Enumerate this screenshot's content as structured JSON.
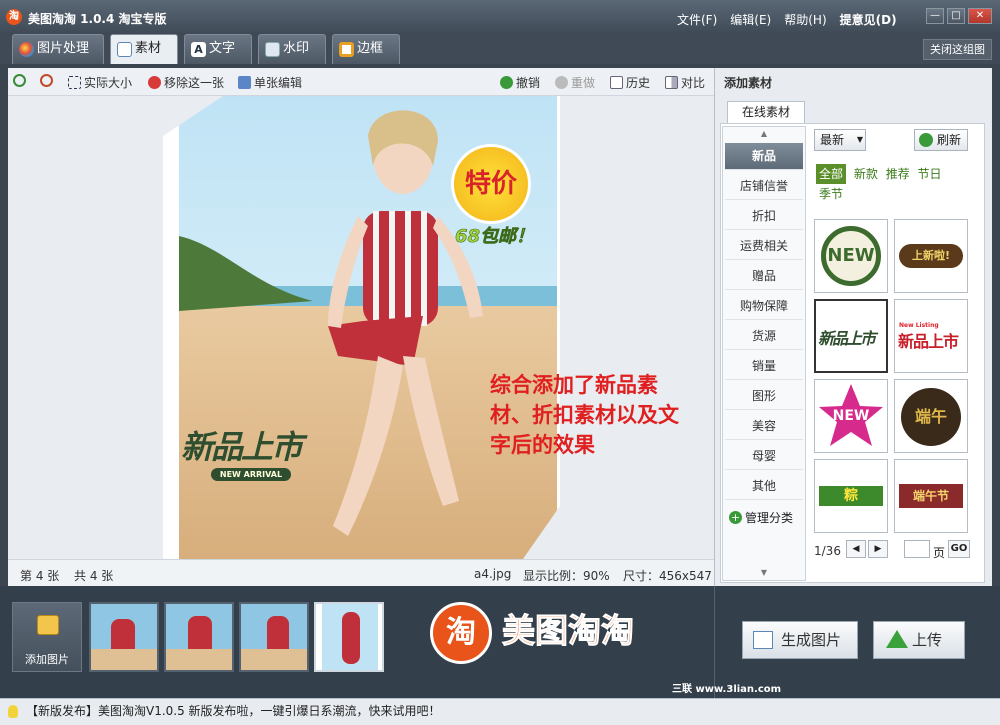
{
  "window": {
    "app_icon": "淘",
    "title": "美图淘淘 1.0.4 淘宝专版",
    "controls": [
      "—",
      "□",
      "✕"
    ]
  },
  "menu": {
    "file": "文件(F)",
    "edit": "编辑(E)",
    "help": "帮助(H)",
    "feedback": "提意见(D)"
  },
  "tabs": [
    {
      "label": "图片处理",
      "icon": "palette-icon"
    },
    {
      "label": "素材",
      "icon": "sticker-icon"
    },
    {
      "label": "文字",
      "icon": "text-icon"
    },
    {
      "label": "水印",
      "icon": "watermark-icon"
    },
    {
      "label": "边框",
      "icon": "frame-icon"
    }
  ],
  "close_group": "关闭这组图",
  "toolbar": {
    "actual_size": "实际大小",
    "remove": "移除这一张",
    "single_edit": "单张编辑",
    "undo": "撤销",
    "redo": "重做",
    "history": "历史",
    "compare": "对比"
  },
  "canvas": {
    "price_tag": "特价",
    "free_shipping": "68包邮！",
    "new_arrival_cn": "新品上市",
    "new_arrival_en": "NEW ARRIVAL",
    "annotation": "综合添加了新品素材、折扣素材以及文字后的效果"
  },
  "status": {
    "index": "第 4 张",
    "total": "共 4 张",
    "filename": "a4.jpg",
    "zoom": "显示比例：90%",
    "size": "尺寸：456x547"
  },
  "right_panel": {
    "title": "添加素材",
    "tab": "在线素材",
    "categories": [
      "新品",
      "店铺信誉",
      "折扣",
      "运费相关",
      "赠品",
      "购物保障",
      "货源",
      "销量",
      "图形",
      "美容",
      "母婴",
      "其他"
    ],
    "manage": "管理分类",
    "sort": "最新",
    "refresh": "刷新",
    "filters": [
      "全部",
      "新款",
      "推荐",
      "节日",
      "季节"
    ],
    "stickers": [
      {
        "text": "NEW",
        "style": "badge"
      },
      {
        "text": "上新啦!",
        "style": "ribbon"
      },
      {
        "text": "新品上市",
        "style": "script"
      },
      {
        "text": "新品上市",
        "style": "red",
        "small": "New Listing"
      },
      {
        "text": "NEW",
        "style": "star"
      },
      {
        "text": "端午",
        "style": "dragon"
      },
      {
        "text": "粽",
        "style": "zongzi"
      },
      {
        "text": "端午节",
        "style": "festival"
      }
    ],
    "pagination": {
      "page": "1/36",
      "page_label": "页",
      "go": "GO"
    }
  },
  "bottom": {
    "add_image": "添加图片",
    "logo_icon": "淘",
    "logo_text": "美图淘淘",
    "generate": "生成图片",
    "upload": "上传",
    "watermark": "三联 www.3lian.com"
  },
  "news": "【新版发布】美图淘淘V1.0.5 新版发布啦，一键引爆日系潮流，快来试用吧！",
  "colors": {
    "accent": "#e8541a",
    "stamp_green": "#3d6b2d",
    "annotation_red": "#e02020"
  }
}
